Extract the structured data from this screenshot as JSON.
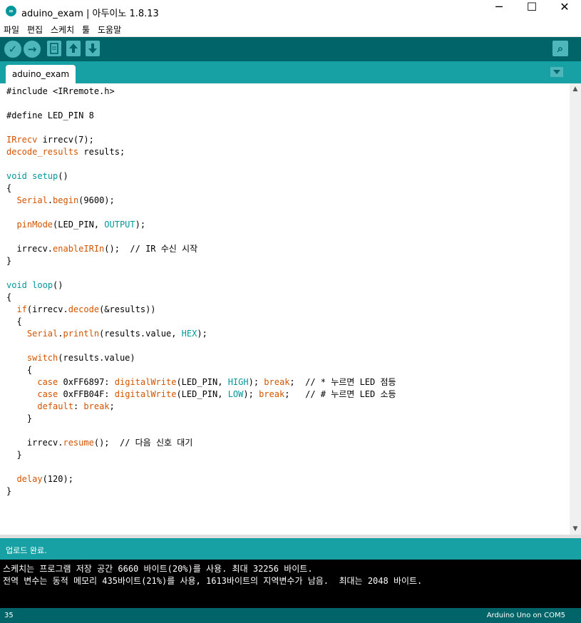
{
  "window": {
    "title": "aduino_exam | 아두이노 1.8.13",
    "app_icon_label": "∞",
    "minimize": "─",
    "maximize": "☐",
    "close": "✕"
  },
  "menu": [
    "파일",
    "편집",
    "스케치",
    "툴",
    "도움말"
  ],
  "toolbar": {
    "verify_icon": "✓",
    "upload_icon": "→",
    "serial_monitor_icon": "⌕"
  },
  "tab": {
    "name": "aduino_exam"
  },
  "code": [
    [
      {
        "t": "#include <IRremote.h>"
      }
    ],
    [],
    [
      {
        "t": "#define LED_PIN 8"
      }
    ],
    [],
    [
      {
        "t": "IRrecv",
        "c": "kw"
      },
      {
        "t": " irrecv(7);"
      }
    ],
    [
      {
        "t": "decode_results",
        "c": "kw"
      },
      {
        "t": " results;"
      }
    ],
    [],
    [
      {
        "t": "void",
        "c": "ty"
      },
      {
        "t": " "
      },
      {
        "t": "setup",
        "c": "ty"
      },
      {
        "t": "()"
      }
    ],
    [
      {
        "t": "{"
      }
    ],
    [
      {
        "t": "  "
      },
      {
        "t": "Serial",
        "c": "fn"
      },
      {
        "t": "."
      },
      {
        "t": "begin",
        "c": "fn"
      },
      {
        "t": "(9600);"
      }
    ],
    [],
    [
      {
        "t": "  "
      },
      {
        "t": "pinMode",
        "c": "fn"
      },
      {
        "t": "(LED_PIN, "
      },
      {
        "t": "OUTPUT",
        "c": "ct"
      },
      {
        "t": ");"
      }
    ],
    [],
    [
      {
        "t": "  irrecv."
      },
      {
        "t": "enableIRIn",
        "c": "fn"
      },
      {
        "t": "();  // IR 수신 시작"
      }
    ],
    [
      {
        "t": "}"
      }
    ],
    [],
    [
      {
        "t": "void",
        "c": "ty"
      },
      {
        "t": " "
      },
      {
        "t": "loop",
        "c": "ty"
      },
      {
        "t": "()"
      }
    ],
    [
      {
        "t": "{"
      }
    ],
    [
      {
        "t": "  "
      },
      {
        "t": "if",
        "c": "kw"
      },
      {
        "t": "(irrecv."
      },
      {
        "t": "decode",
        "c": "fn"
      },
      {
        "t": "(&results))"
      }
    ],
    [
      {
        "t": "  {"
      }
    ],
    [
      {
        "t": "    "
      },
      {
        "t": "Serial",
        "c": "fn"
      },
      {
        "t": "."
      },
      {
        "t": "println",
        "c": "fn"
      },
      {
        "t": "(results.value, "
      },
      {
        "t": "HEX",
        "c": "ct"
      },
      {
        "t": ");"
      }
    ],
    [],
    [
      {
        "t": "    "
      },
      {
        "t": "switch",
        "c": "kw"
      },
      {
        "t": "(results.value)"
      }
    ],
    [
      {
        "t": "    {"
      }
    ],
    [
      {
        "t": "      "
      },
      {
        "t": "case",
        "c": "kw"
      },
      {
        "t": " 0xFF6897: "
      },
      {
        "t": "digitalWrite",
        "c": "fn"
      },
      {
        "t": "(LED_PIN, "
      },
      {
        "t": "HIGH",
        "c": "ct"
      },
      {
        "t": "); "
      },
      {
        "t": "break",
        "c": "kw"
      },
      {
        "t": ";  // * 누르면 LED 점등"
      }
    ],
    [
      {
        "t": "      "
      },
      {
        "t": "case",
        "c": "kw"
      },
      {
        "t": " 0xFFB04F: "
      },
      {
        "t": "digitalWrite",
        "c": "fn"
      },
      {
        "t": "(LED_PIN, "
      },
      {
        "t": "LOW",
        "c": "ct"
      },
      {
        "t": "); "
      },
      {
        "t": "break",
        "c": "kw"
      },
      {
        "t": ";   // # 누르면 LED 소등"
      }
    ],
    [
      {
        "t": "      "
      },
      {
        "t": "default",
        "c": "kw"
      },
      {
        "t": ": "
      },
      {
        "t": "break",
        "c": "kw"
      },
      {
        "t": ";"
      }
    ],
    [
      {
        "t": "    }"
      }
    ],
    [],
    [
      {
        "t": "    irrecv."
      },
      {
        "t": "resume",
        "c": "fn"
      },
      {
        "t": "();  // 다음 신호 대기"
      }
    ],
    [
      {
        "t": "  }"
      }
    ],
    [],
    [
      {
        "t": "  "
      },
      {
        "t": "delay",
        "c": "fn"
      },
      {
        "t": "(120);"
      }
    ],
    [
      {
        "t": "}"
      }
    ]
  ],
  "status": {
    "message": "업로드 완료."
  },
  "console": [
    "스케치는 프로그램 저장 공간 6660 바이트(20%)를 사용. 최대 32256 바이트.",
    "전역 변수는 동적 메모리 435바이트(21%)를 사용, 1613바이트의 지역변수가 남음.  최대는 2048 바이트."
  ],
  "footer": {
    "line": "35",
    "board": "Arduino Uno on COM5"
  },
  "colors": {
    "toolbar": "#006468",
    "tabbar": "#17a1a5",
    "keyword": "#d35400",
    "constant": "#00979c"
  }
}
